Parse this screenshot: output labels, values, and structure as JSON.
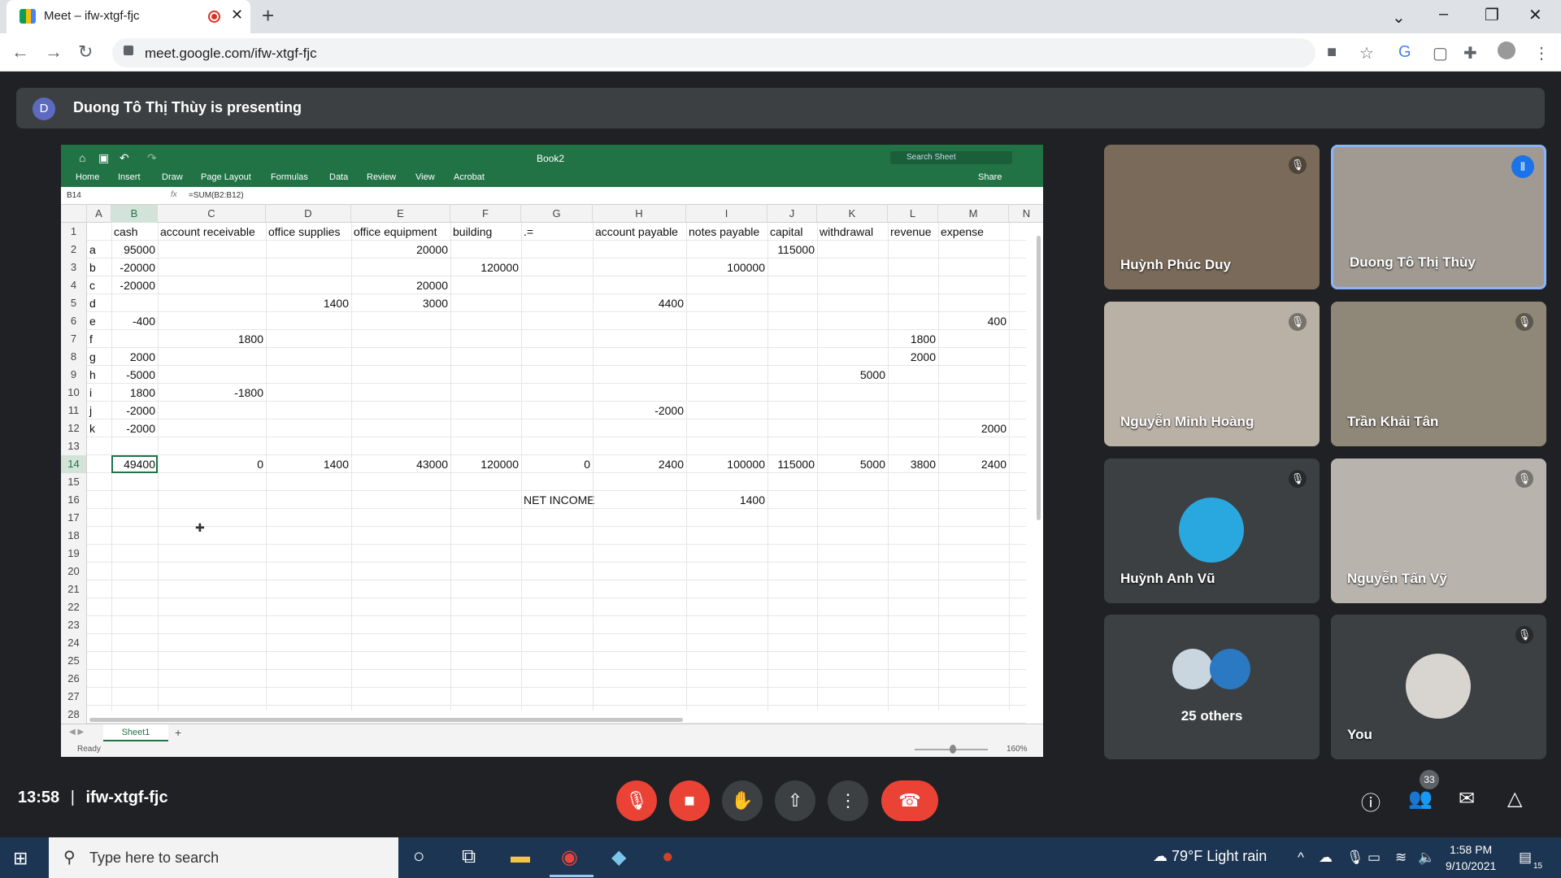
{
  "browser": {
    "tab_title": "Meet – ifw-xtgf-fjc",
    "url": "meet.google.com/ifw-xtgf-fjc"
  },
  "banner": {
    "avatar_letter": "D",
    "text": "Duong Tô Thị Thùy is presenting"
  },
  "excel": {
    "book_title": "Book2",
    "search_placeholder": "Search Sheet",
    "share_label": "Share",
    "ribbon": [
      "Home",
      "Insert",
      "Draw",
      "Page Layout",
      "Formulas",
      "Data",
      "Review",
      "View",
      "Acrobat"
    ],
    "name_box": "B14",
    "formula": "=SUM(B2:B12)",
    "fx": "fx",
    "columns": [
      "A",
      "B",
      "C",
      "D",
      "E",
      "F",
      "G",
      "H",
      "I",
      "J",
      "K",
      "L",
      "M",
      "N"
    ],
    "rows": [
      [
        "",
        "cash",
        "account receivable",
        "office supplies",
        "office equipment",
        "building",
        ".=",
        "account payable",
        "notes payable",
        "capital",
        "withdrawal",
        "revenue",
        "expense"
      ],
      [
        "a",
        "95000",
        "",
        "",
        "20000",
        "",
        "",
        "",
        "",
        "115000",
        "",
        "",
        ""
      ],
      [
        "b",
        "-20000",
        "",
        "",
        "",
        "120000",
        "",
        "",
        "100000",
        "",
        "",
        "",
        ""
      ],
      [
        "c",
        "-20000",
        "",
        "",
        "20000",
        "",
        "",
        "",
        "",
        "",
        "",
        "",
        ""
      ],
      [
        "d",
        "",
        "",
        "1400",
        "3000",
        "",
        "",
        "4400",
        "",
        "",
        "",
        "",
        ""
      ],
      [
        "e",
        "-400",
        "",
        "",
        "",
        "",
        "",
        "",
        "",
        "",
        "",
        "",
        "400"
      ],
      [
        "f",
        "",
        "1800",
        "",
        "",
        "",
        "",
        "",
        "",
        "",
        "",
        "1800",
        ""
      ],
      [
        "g",
        "2000",
        "",
        "",
        "",
        "",
        "",
        "",
        "",
        "",
        "",
        "2000",
        ""
      ],
      [
        "h",
        "-5000",
        "",
        "",
        "",
        "",
        "",
        "",
        "",
        "",
        "5000",
        "",
        ""
      ],
      [
        "i",
        "1800",
        "-1800",
        "",
        "",
        "",
        "",
        "",
        "",
        "",
        "",
        "",
        ""
      ],
      [
        "j",
        "-2000",
        "",
        "",
        "",
        "",
        "",
        "-2000",
        "",
        "",
        "",
        "",
        ""
      ],
      [
        "k",
        "-2000",
        "",
        "",
        "",
        "",
        "",
        "",
        "",
        "",
        "",
        "",
        "2000"
      ],
      [
        "",
        "",
        "",
        "",
        "",
        "",
        "",
        "",
        "",
        "",
        "",
        "",
        ""
      ],
      [
        "",
        "49400",
        "0",
        "1400",
        "43000",
        "120000",
        "0",
        "2400",
        "100000",
        "115000",
        "5000",
        "3800",
        "2400"
      ],
      [
        "",
        "",
        "",
        "",
        "",
        "",
        "",
        "",
        "",
        "",
        "",
        "",
        ""
      ],
      [
        "",
        "",
        "",
        "",
        "",
        "",
        "NET INCOME",
        "",
        "1400",
        "",
        "",
        "",
        ""
      ]
    ],
    "row_count": 28,
    "sheet_tab": "Sheet1",
    "status_ready": "Ready",
    "zoom": "160%"
  },
  "participants": [
    {
      "name": "Huỳnh Phúc Duy",
      "muted": true
    },
    {
      "name": "Duong Tô Thị Thùy",
      "muted": false,
      "speaking": true
    },
    {
      "name": "Nguyễn Minh Hoàng",
      "muted": true
    },
    {
      "name": "Trần Khải Tân",
      "muted": true
    },
    {
      "name": "Huỳnh Anh Vũ",
      "muted": true
    },
    {
      "name": "Nguyễn Tấn Vỹ",
      "muted": true
    },
    {
      "name": "25 others"
    },
    {
      "name": "You",
      "muted": true
    }
  ],
  "meeting": {
    "time": "13:58",
    "code": "ifw-xtgf-fjc",
    "people_count": "33"
  },
  "taskbar": {
    "search_placeholder": "Type here to search",
    "weather": "79°F  Light rain",
    "clock_time": "1:58 PM",
    "clock_date": "9/10/2021",
    "notif_count": "15"
  },
  "colors": {
    "excel_green": "#217346",
    "end_call_red": "#ea4335",
    "meet_bg": "#202124"
  }
}
